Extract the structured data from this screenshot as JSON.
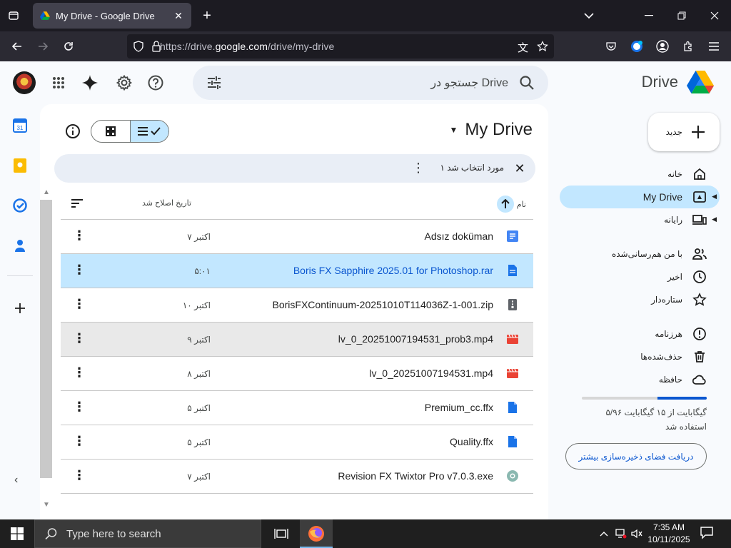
{
  "browser": {
    "tab_title": "My Drive - Google Drive",
    "url_prefix": "https://drive.",
    "url_domain": "google.com",
    "url_path": "/drive/my-drive"
  },
  "drive": {
    "brand": "Drive",
    "search_placeholder": "جستجو در Drive",
    "page_title": "My Drive",
    "selection_text": "۱ مورد انتخاب شد",
    "col_name": "نام",
    "col_modified": "تاریخ اصلاح شد",
    "files": [
      {
        "name": "Adsız doküman",
        "date": "۷ اکتبر",
        "type": "doc"
      },
      {
        "name": "Boris FX Sapphire 2025.01 for Photoshop.rar",
        "date": "۵:۰۱",
        "type": "file"
      },
      {
        "name": "BorisFXContinuum-20251010T114036Z-1-001.zip",
        "date": "۱۰ اکتبر",
        "type": "zip"
      },
      {
        "name": "lv_0_20251007194531_prob3.mp4",
        "date": "۹ اکتبر",
        "type": "video"
      },
      {
        "name": "lv_0_20251007194531.mp4",
        "date": "۸ اکتبر",
        "type": "video"
      },
      {
        "name": "Premium_cc.ffx",
        "date": "۵ اکتبر",
        "type": "file"
      },
      {
        "name": "Quality.ffx",
        "date": "۵ اکتبر",
        "type": "file"
      },
      {
        "name": "Revision FX Twixtor Pro v7.0.3.exe",
        "date": "۷ اکتبر",
        "type": "exe"
      }
    ],
    "sidebar": {
      "new_label": "جدید",
      "home": "خانه",
      "my_drive": "My Drive",
      "computers": "رایانه",
      "shared": "با من هم‌رسانی‌شده",
      "recent": "اخیر",
      "starred": "ستاره‌دار",
      "spam": "هرزنامه",
      "trash": "حذف‌شده‌ها",
      "storage": "حافظه"
    },
    "storage": {
      "used_text": "۵/۹۶ گیگابایت از ۱۵ گیگابایت",
      "used_suffix": "استفاده شد",
      "used_fraction": 0.397,
      "button": "دریافت فضای ذخیره‌سازی بیشتر"
    }
  },
  "taskbar": {
    "search_placeholder": "Type here to search",
    "time": "7:35 AM",
    "date": "10/11/2025"
  },
  "colors": {
    "selected_row": "#c2e7ff",
    "accent_blue": "#0b57d0"
  }
}
